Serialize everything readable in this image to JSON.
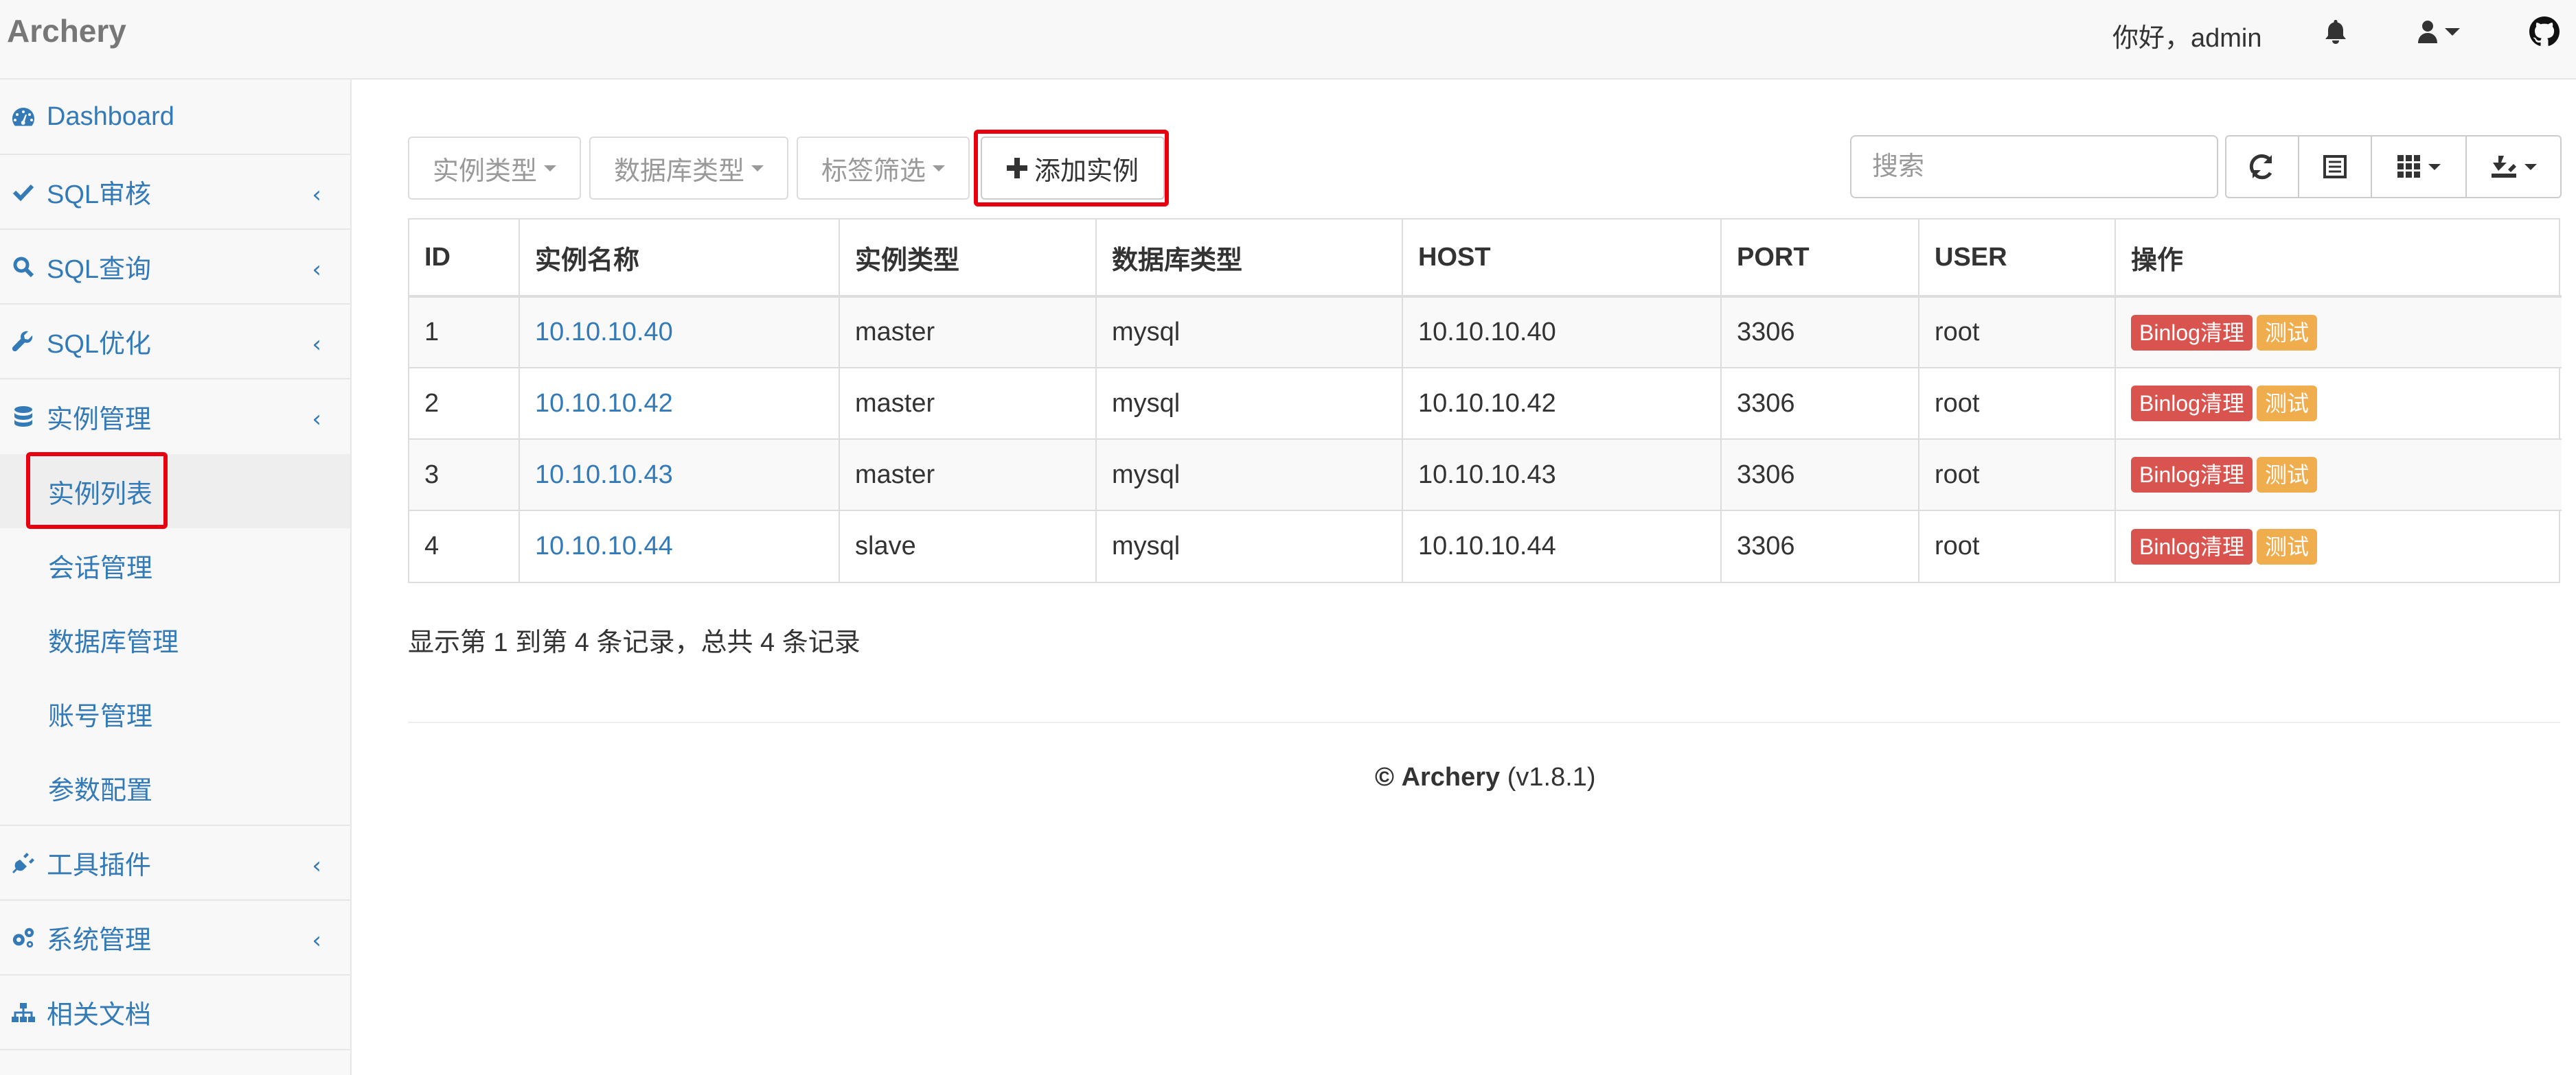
{
  "app": {
    "brand": "Archery",
    "greeting": "你好，admin"
  },
  "sidebar": {
    "items": [
      {
        "label": "Dashboard",
        "icon": "dashboard-icon"
      },
      {
        "label": "SQL审核",
        "icon": "check-icon"
      },
      {
        "label": "SQL查询",
        "icon": "search-icon"
      },
      {
        "label": "SQL优化",
        "icon": "wrench-icon"
      },
      {
        "label": "实例管理",
        "icon": "database-icon"
      }
    ],
    "sub_items": [
      "实例列表",
      "会话管理",
      "数据库管理",
      "账号管理",
      "参数配置"
    ],
    "items_after": [
      {
        "label": "工具插件",
        "icon": "plug-icon"
      },
      {
        "label": "系统管理",
        "icon": "cogs-icon"
      },
      {
        "label": "相关文档",
        "icon": "sitemap-icon"
      }
    ]
  },
  "toolbar": {
    "filter_instance_type": "实例类型",
    "filter_db_type": "数据库类型",
    "filter_tags": "标签筛选",
    "add_instance": "添加实例",
    "search_placeholder": "搜索"
  },
  "table": {
    "headers": [
      "ID",
      "实例名称",
      "实例类型",
      "数据库类型",
      "HOST",
      "PORT",
      "USER",
      "操作"
    ],
    "rows": [
      [
        "1",
        "10.10.10.40",
        "master",
        "mysql",
        "10.10.10.40",
        "3306",
        "root"
      ],
      [
        "2",
        "10.10.10.42",
        "master",
        "mysql",
        "10.10.10.42",
        "3306",
        "root"
      ],
      [
        "3",
        "10.10.10.43",
        "master",
        "mysql",
        "10.10.10.43",
        "3306",
        "root"
      ],
      [
        "4",
        "10.10.10.44",
        "slave",
        "mysql",
        "10.10.10.44",
        "3306",
        "root"
      ]
    ],
    "action_binlog": "Binlog清理",
    "action_test": "测试"
  },
  "pagination": {
    "info": "显示第 1 到第 4 条记录，总共 4 条记录"
  },
  "footer": {
    "copyright": "©",
    "brand": "Archery",
    "version": "(v1.8.1)"
  },
  "colors": {
    "link": "#337ab7",
    "danger": "#d9534f",
    "warning": "#f0ad4e",
    "highlight": "#e60012"
  }
}
